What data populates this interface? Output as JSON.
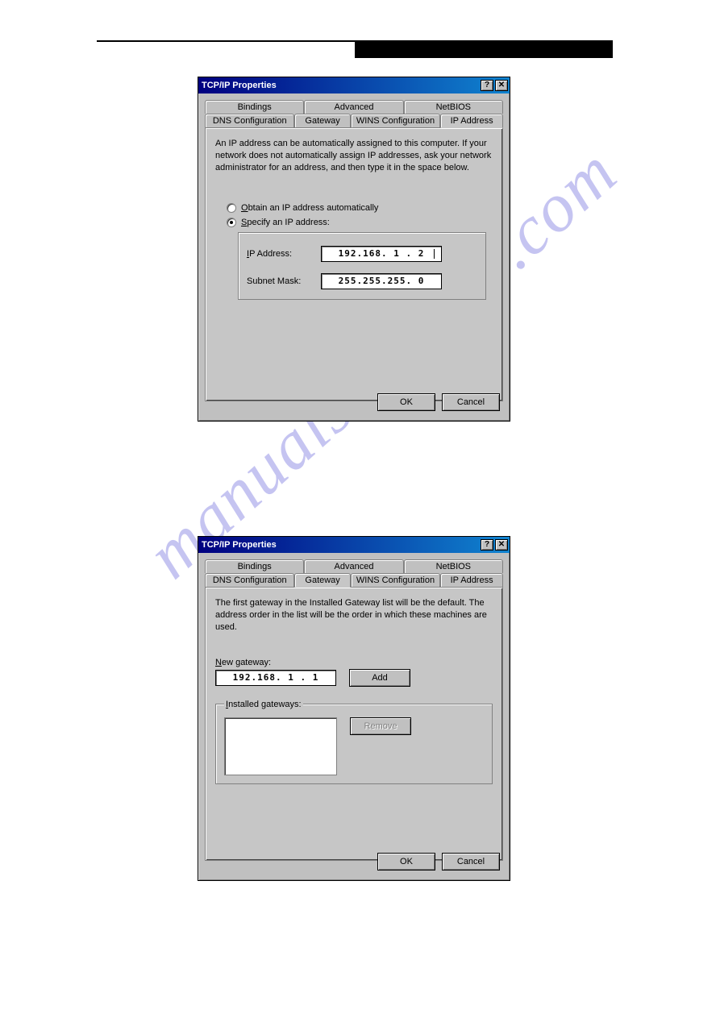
{
  "watermark_text": "manualsarchive.com",
  "dialog1": {
    "title": "TCP/IP Properties",
    "tabs_row1": [
      "Bindings",
      "Advanced",
      "NetBIOS"
    ],
    "tabs_row2": [
      "DNS Configuration",
      "Gateway",
      "WINS Configuration",
      "IP Address"
    ],
    "active_tab": "IP Address",
    "description": "An IP address can be automatically assigned to this computer. If your network does not automatically assign IP addresses, ask your network administrator for an address, and then type it in the space below.",
    "radio_obtain": "Obtain an IP address automatically",
    "radio_specify": "Specify an IP address:",
    "ip_label": "IP Address:",
    "ip_value": "192.168.  1 .  2",
    "subnet_label": "Subnet Mask:",
    "subnet_value": "255.255.255.  0",
    "ok": "OK",
    "cancel": "Cancel"
  },
  "dialog2": {
    "title": "TCP/IP Properties",
    "tabs_row1": [
      "Bindings",
      "Advanced",
      "NetBIOS"
    ],
    "tabs_row2": [
      "DNS Configuration",
      "Gateway",
      "WINS Configuration",
      "IP Address"
    ],
    "active_tab": "Gateway",
    "description": "The first gateway in the Installed Gateway list will be the default. The address order in the list will be the order in which these machines are used.",
    "new_gateway_label": "New gateway:",
    "new_gateway_value": "192.168. 1 . 1",
    "add": "Add",
    "installed_label": "Installed gateways:",
    "remove": "Remove",
    "ok": "OK",
    "cancel": "Cancel"
  }
}
